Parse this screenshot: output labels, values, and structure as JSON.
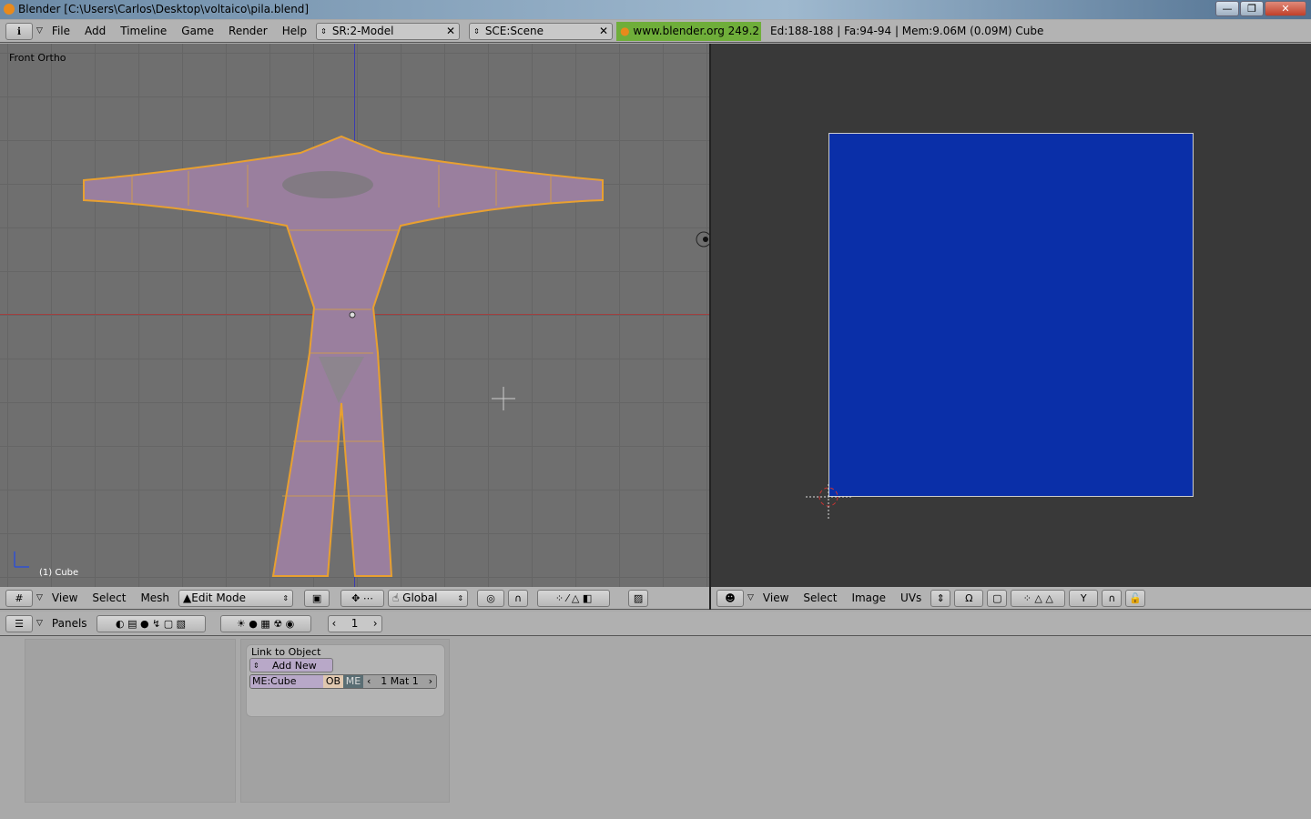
{
  "window": {
    "title": "Blender [C:\\Users\\Carlos\\Desktop\\voltaico\\pila.blend]",
    "controls": [
      "—",
      "❐",
      "✕"
    ]
  },
  "top_header": {
    "menus": [
      "File",
      "Add",
      "Timeline",
      "Game",
      "Render",
      "Help"
    ],
    "screen": "SR:2-Model",
    "scene": "SCE:Scene",
    "version": "www.blender.org 249.2",
    "stats": "Ed:188-188 | Fa:94-94 | Mem:9.06M (0.09M) Cube"
  },
  "viewport": {
    "view_name": "Front Ortho",
    "object_label": "(1) Cube",
    "menus": [
      "View",
      "Select",
      "Mesh"
    ],
    "mode": "Edit Mode",
    "orientation": "Global"
  },
  "uv_editor": {
    "menus": [
      "View",
      "Select",
      "Image",
      "UVs"
    ],
    "image_color": "#0a2fa8"
  },
  "buttons": {
    "menus": [
      "Panels"
    ],
    "frame": "1",
    "panel_title": "Link to Object",
    "add_new": "Add New",
    "mesh_name": "ME:Cube",
    "ob": "OB",
    "me": "ME",
    "mat": "1 Mat 1"
  },
  "colors": {
    "mesh": "#9a7f9e",
    "edge": "#e8a030",
    "version_bg": "#6fae3a"
  }
}
